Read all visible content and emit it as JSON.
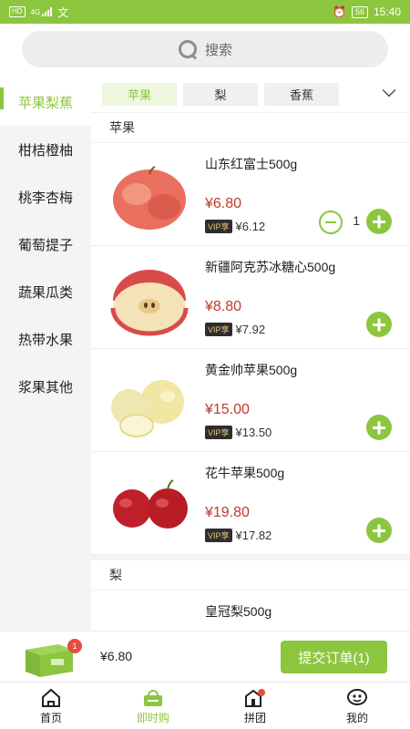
{
  "status_bar": {
    "sim_label": "HD",
    "network_label": "4G",
    "extra_label": "文",
    "battery": "56",
    "time": "15:40"
  },
  "search": {
    "placeholder": "搜索"
  },
  "sidebar": {
    "items": [
      {
        "label": "苹果梨蕉",
        "active": true
      },
      {
        "label": "柑桔橙柚",
        "active": false
      },
      {
        "label": "桃李杏梅",
        "active": false
      },
      {
        "label": "葡萄提子",
        "active": false
      },
      {
        "label": "蔬果瓜类",
        "active": false
      },
      {
        "label": "热带水果",
        "active": false
      },
      {
        "label": "浆果其他",
        "active": false
      }
    ]
  },
  "tabs": [
    {
      "label": "苹果",
      "active": true
    },
    {
      "label": "梨",
      "active": false
    },
    {
      "label": "香蕉",
      "active": false
    }
  ],
  "sections": [
    {
      "title": "苹果",
      "products": [
        {
          "name": "山东红富士500g",
          "price": "¥6.80",
          "vip_badge": "VIP享",
          "vip_price": "¥6.12",
          "quantity": "1"
        },
        {
          "name": "新疆阿克苏冰糖心500g",
          "price": "¥8.80",
          "vip_badge": "VIP享",
          "vip_price": "¥7.92"
        },
        {
          "name": "黄金帅苹果500g",
          "price": "¥15.00",
          "vip_badge": "VIP享",
          "vip_price": "¥13.50"
        },
        {
          "name": "花牛苹果500g",
          "price": "¥19.80",
          "vip_badge": "VIP享",
          "vip_price": "¥17.82"
        }
      ]
    },
    {
      "title": "梨",
      "products": [
        {
          "name": "皇冠梨500g"
        }
      ]
    }
  ],
  "cart": {
    "badge_count": "1",
    "total": "¥6.80",
    "submit_label": "提交订单(1)"
  },
  "bottom_nav": [
    {
      "label": "首页",
      "icon": "home-icon",
      "active": false
    },
    {
      "label": "即时购",
      "icon": "basket-icon",
      "active": true
    },
    {
      "label": "拼团",
      "icon": "group-buy-icon",
      "active": false
    },
    {
      "label": "我的",
      "icon": "profile-icon",
      "active": false
    }
  ],
  "colors": {
    "accent": "#8cc63f",
    "price_red": "#c0392b",
    "badge_red": "#e74c3c"
  }
}
